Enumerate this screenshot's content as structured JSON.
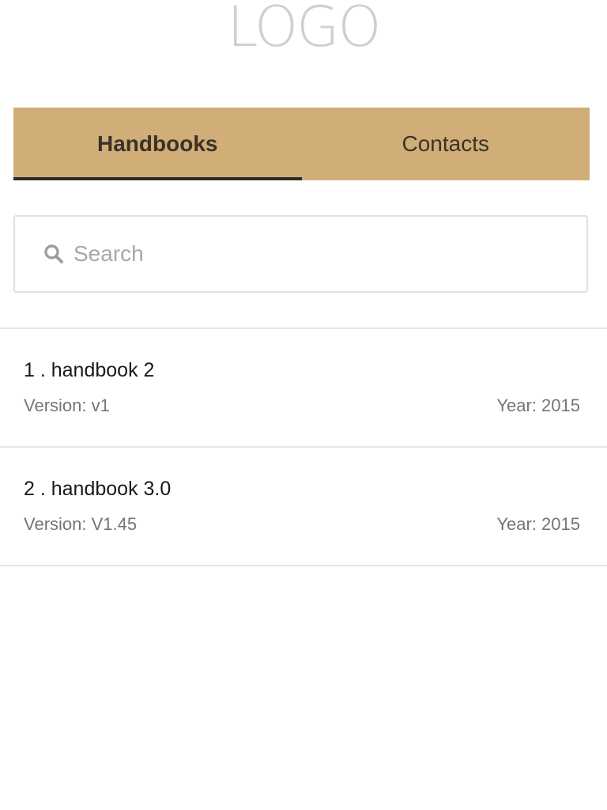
{
  "header": {
    "logo_text": "LOGO"
  },
  "tabs": [
    {
      "label": "Handbooks",
      "active": true
    },
    {
      "label": "Contacts",
      "active": false
    }
  ],
  "colors": {
    "tab_bar_background": "#d1ad78",
    "active_tab_indicator": "#2d2a26"
  },
  "search": {
    "placeholder": "Search",
    "value": "",
    "icon": "search-icon"
  },
  "handbooks": [
    {
      "title": "1 . handbook 2",
      "version": "Version: v1",
      "year": "Year: 2015"
    },
    {
      "title": "2 . handbook 3.0",
      "version": "Version: V1.45",
      "year": "Year: 2015"
    }
  ]
}
